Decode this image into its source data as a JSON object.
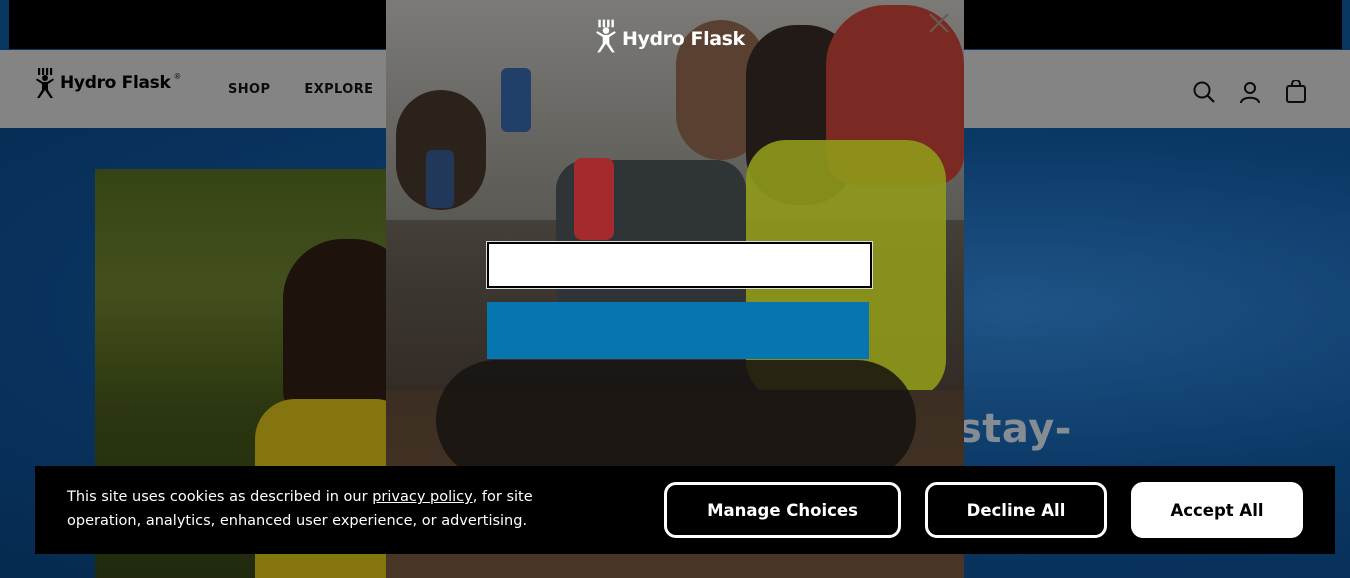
{
  "header": {
    "logo_text": "Hydro Flask",
    "logo_mark": "®",
    "nav": [
      {
        "label": "SHOP"
      },
      {
        "label": "EXPLORE"
      }
    ],
    "icons": [
      "search-icon",
      "account-icon",
      "cart-icon"
    ]
  },
  "hero": {
    "headline_fragment": "stay-"
  },
  "modal": {
    "logo_text": "Hydro Flask",
    "email_value": "",
    "submit_label": ""
  },
  "cookie_banner": {
    "text_before_link": "This site uses cookies as described in our ",
    "link_text": "privacy policy",
    "text_after_link": ", for site operation, analytics, enhanced user experience, or advertising.",
    "manage_label": "Manage Choices",
    "decline_label": "Decline All",
    "accept_label": "Accept All"
  },
  "colors": {
    "accent_blue": "#0576b0",
    "banner_bg": "#000000",
    "hero_blue": "#0f4f8e"
  }
}
